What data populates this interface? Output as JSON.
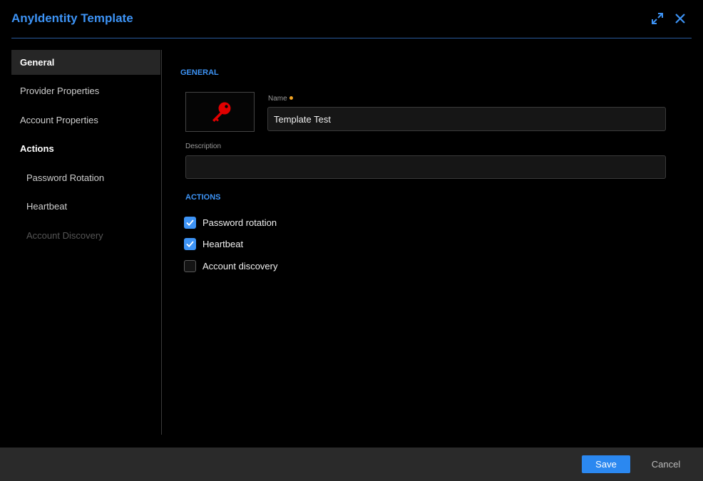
{
  "dialog": {
    "title": "AnyIdentity Template",
    "expand_icon": "expand-icon",
    "close_icon": "close-icon"
  },
  "sidebar": {
    "items": [
      {
        "label": "General",
        "state": "selected"
      },
      {
        "label": "Provider Properties",
        "state": "normal"
      },
      {
        "label": "Account Properties",
        "state": "normal"
      },
      {
        "label": "Actions",
        "state": "group-header"
      },
      {
        "label": "Password Rotation",
        "state": "sub-item"
      },
      {
        "label": "Heartbeat",
        "state": "sub-item"
      },
      {
        "label": "Account Discovery",
        "state": "disabled"
      }
    ]
  },
  "general": {
    "section_title": "GENERAL",
    "image_icon": "key-icon",
    "name_label": "Name",
    "name_value": "Template Test",
    "description_label": "Description",
    "description_value": ""
  },
  "actions": {
    "section_title": "ACTIONS",
    "options": [
      {
        "label": "Password rotation",
        "checked": true
      },
      {
        "label": "Heartbeat",
        "checked": true
      },
      {
        "label": "Account discovery",
        "checked": false
      }
    ]
  },
  "footer": {
    "save_label": "Save",
    "cancel_label": "Cancel"
  },
  "colors": {
    "accent": "#3d93f5",
    "key_icon": "#e00000",
    "required_dot": "#f5a623"
  }
}
